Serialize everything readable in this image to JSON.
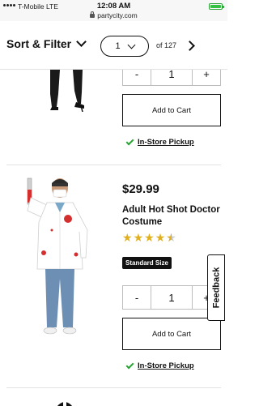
{
  "status_bar": {
    "carrier": "T-Mobile  LTE",
    "time": "12:08 AM",
    "url": "partycity.com",
    "battery_level": 1.0
  },
  "toolbar": {
    "sort_filter_label": "Sort & Filter",
    "current_page": "1",
    "page_count_label": "of 127"
  },
  "products": [
    {
      "quantity": "1",
      "minus_label": "-",
      "plus_label": "+",
      "add_to_cart_label": "Add to Cart",
      "pickup_label": "In-Store Pickup"
    },
    {
      "price": "$29.99",
      "title": "Adult Hot Shot Doctor Costume",
      "rating": 4.5,
      "rating_max": 5,
      "size_badge": "Standard Size",
      "quantity": "1",
      "minus_label": "-",
      "plus_label": "+",
      "add_to_cart_label": "Add to Cart",
      "pickup_label": "In-Store Pickup"
    }
  ],
  "feedback_tab": {
    "label": "Feedback"
  },
  "colors": {
    "accent_green": "#2aa336",
    "star_gold": "#e0b01f",
    "badge_black": "#111111"
  }
}
